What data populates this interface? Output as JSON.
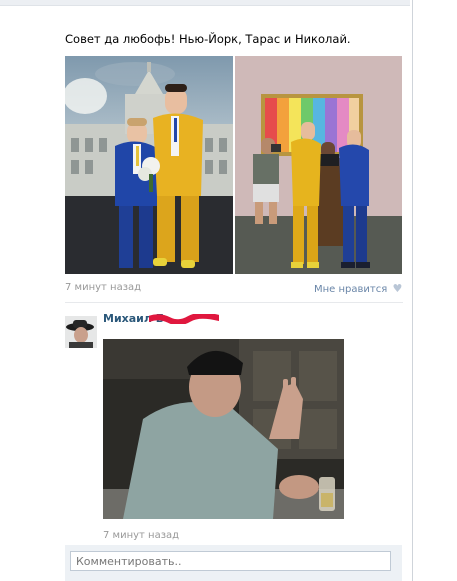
{
  "post": {
    "text": "Совет да любофь! Нью-Йорк, Тарас и Николай.",
    "time": "7 минут назад",
    "like_label": "Мне нравится",
    "like_icon": "heart-icon"
  },
  "comment": {
    "author": "Михаил Б",
    "time": "7 минут назад"
  },
  "reply": {
    "placeholder": "Комментировать.."
  },
  "colors": {
    "link": "#2b587a",
    "like": "#6a86a8",
    "muted": "#999999",
    "redaction": "#e0173e"
  }
}
